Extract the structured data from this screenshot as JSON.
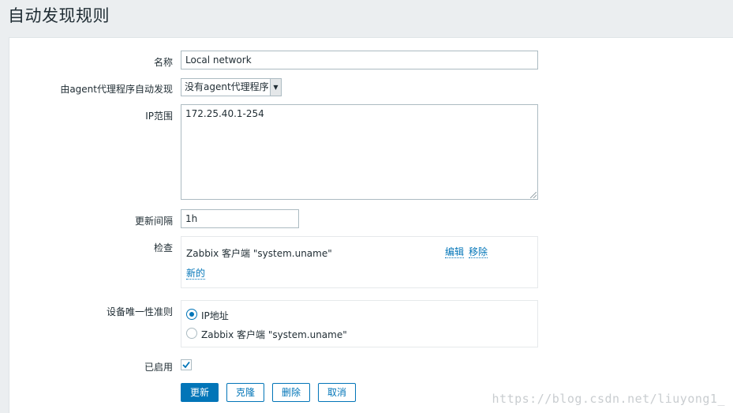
{
  "page": {
    "title": "自动发现规则"
  },
  "form": {
    "name": {
      "label": "名称",
      "value": "Local network"
    },
    "proxy": {
      "label": "由agent代理程序自动发现",
      "selected": "没有agent代理程序"
    },
    "ip_range": {
      "label": "IP范围",
      "value": "172.25.40.1-254"
    },
    "interval": {
      "label": "更新间隔",
      "value": "1h"
    },
    "checks": {
      "label": "检查",
      "items": [
        {
          "name": "Zabbix 客户端 \"system.uname\"",
          "edit": "编辑",
          "remove": "移除"
        }
      ],
      "new_link": "新的"
    },
    "uniqueness": {
      "label": "设备唯一性准则",
      "options": [
        {
          "label": "IP地址",
          "checked": true
        },
        {
          "label": "Zabbix 客户端 \"system.uname\"",
          "checked": false
        }
      ]
    },
    "enabled": {
      "label": "已启用",
      "checked": true
    }
  },
  "buttons": {
    "update": "更新",
    "clone": "克隆",
    "delete": "删除",
    "cancel": "取消"
  },
  "watermark": "https://blog.csdn.net/liuyong1_",
  "colors": {
    "accent": "#0275b8",
    "page_bg": "#ebeef0",
    "border": "#acbbc2"
  },
  "icons": {
    "checkbox": "checkmark-icon",
    "select": "triangle-down-icon"
  }
}
